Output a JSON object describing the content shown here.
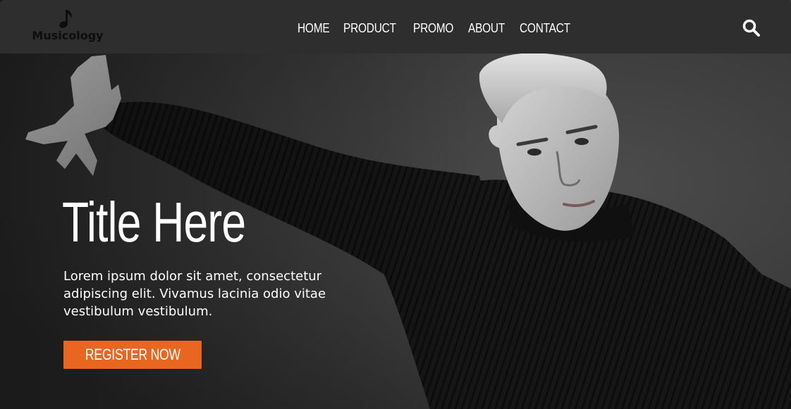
{
  "brand": {
    "name": "Musicology",
    "icon": "music-note-icon"
  },
  "nav": {
    "items": [
      {
        "label": "HOME"
      },
      {
        "label": "PRODUCT"
      },
      {
        "label": "PROMO"
      },
      {
        "label": "ABOUT"
      },
      {
        "label": "CONTACT"
      }
    ],
    "search_icon": "search-icon"
  },
  "hero": {
    "title": "Title Here",
    "description": "Lorem ipsum dolor sit amet, consectetur adipiscing elit. Vivamus lacinia odio vitae vestibulum vestibulum.",
    "cta_label": "REGISTER NOW"
  },
  "colors": {
    "navbar_bg": "#2e2e2e",
    "accent": "#e8661f",
    "text": "#ffffff"
  }
}
